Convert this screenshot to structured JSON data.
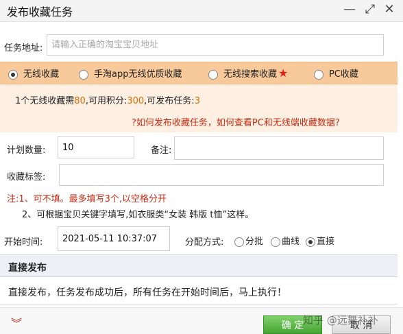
{
  "window": {
    "title": "发布收藏任务",
    "minimize_glyph": "—",
    "maximize_glyph": "⤢",
    "close_glyph": "✕"
  },
  "task_url": {
    "label": "任务地址:",
    "placeholder": "请输入正确的淘宝宝贝地址",
    "value": ""
  },
  "collect_types": {
    "selected": "无线收藏",
    "options": [
      "无线收藏",
      "手淘app无线优质收藏",
      "无线搜索收藏",
      "PC收藏"
    ],
    "star_icon": "★"
  },
  "info": {
    "part1": "1个无线收藏需",
    "cost": "80",
    "part2": ",可用积分:",
    "points": "300",
    "part3": ",可发布任务:",
    "tasks": "3",
    "help_link": "?如何发布收藏任务，如何查看PC和无线端收藏数据?"
  },
  "form": {
    "quantity_label": "计划数量:",
    "quantity_value": "10",
    "remark_label": "备注:",
    "remark_value": "",
    "tags_label": "收藏标签:",
    "tags_value": ""
  },
  "notes": {
    "line1": "注:1、可不填。最多填写3个,以空格分开",
    "line2": "2、可根据宝贝关键字填写,如衣服类“女装 韩版 t恤”这样。"
  },
  "schedule": {
    "start_label": "开始时间:",
    "start_value": "2021-05-11 10:37:07",
    "distribution_label": "分配方式:",
    "options": [
      "分批",
      "曲线",
      "直接"
    ],
    "selected": "直接"
  },
  "direct_publish": {
    "heading": "直接发布",
    "description": "直接发布，任务发布成功后，所有任务在开始时间后，马上执行！"
  },
  "footer": {
    "expand_glyph": "︾",
    "ok_label": "确 定",
    "cancel_label": "取 消",
    "watermark": "知乎 @远舞补补"
  },
  "colors": {
    "orange_bar": "#f8c99a",
    "info_bg": "#fdf0e2",
    "highlight": "#e06a00",
    "note_red": "#cc2a12",
    "ok_green": "#46a532"
  }
}
